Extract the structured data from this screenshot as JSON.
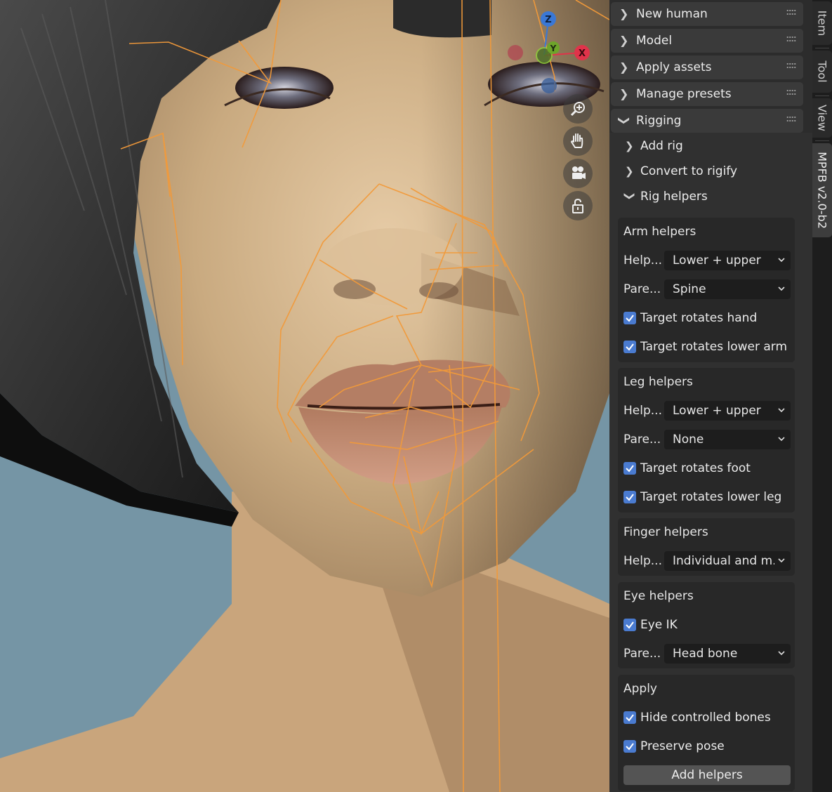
{
  "viewport": {
    "gizmo_axes": [
      "Z",
      "Y",
      "X"
    ],
    "nav_buttons": [
      {
        "name": "zoom-icon"
      },
      {
        "name": "hand-pan-icon"
      },
      {
        "name": "camera-icon"
      },
      {
        "name": "lock-icon"
      }
    ]
  },
  "panel": {
    "sections": [
      {
        "label": "New human",
        "expanded": false
      },
      {
        "label": "Model",
        "expanded": false
      },
      {
        "label": "Apply assets",
        "expanded": false
      },
      {
        "label": "Manage presets",
        "expanded": false
      },
      {
        "label": "Rigging",
        "expanded": true
      }
    ],
    "rigging_subs": [
      {
        "label": "Add rig",
        "expanded": false
      },
      {
        "label": "Convert to rigify",
        "expanded": false
      },
      {
        "label": "Rig helpers",
        "expanded": true
      }
    ],
    "arm": {
      "title": "Arm helpers",
      "helpers_label": "Help...",
      "helpers_value": "Lower + upper",
      "parent_label": "Pare...",
      "parent_value": "Spine",
      "check1": "Target rotates hand",
      "check2": "Target rotates lower arm"
    },
    "leg": {
      "title": "Leg helpers",
      "helpers_label": "Help...",
      "helpers_value": "Lower + upper",
      "parent_label": "Pare...",
      "parent_value": "None",
      "check1": "Target rotates foot",
      "check2": "Target rotates lower leg"
    },
    "finger": {
      "title": "Finger helpers",
      "helpers_label": "Help...",
      "helpers_value": "Individual and m..."
    },
    "eye": {
      "title": "Eye helpers",
      "check1": "Eye IK",
      "parent_label": "Pare...",
      "parent_value": "Head bone"
    },
    "apply": {
      "title": "Apply",
      "check1": "Hide controlled bones",
      "check2": "Preserve pose",
      "button": "Add helpers"
    }
  },
  "tabs": [
    "Item",
    "Tool",
    "View",
    "MPFB v2.0-b2"
  ],
  "active_tab": "MPFB v2.0-b2",
  "colors": {
    "panel_bg": "#2c2c2c",
    "header_bg": "#3a3a3a",
    "checkbox": "#4a7bd0",
    "bone_wire": "#f29a3a",
    "axis_x": "#e0334a",
    "axis_y": "#6ea52a",
    "axis_z": "#3a78d6"
  }
}
